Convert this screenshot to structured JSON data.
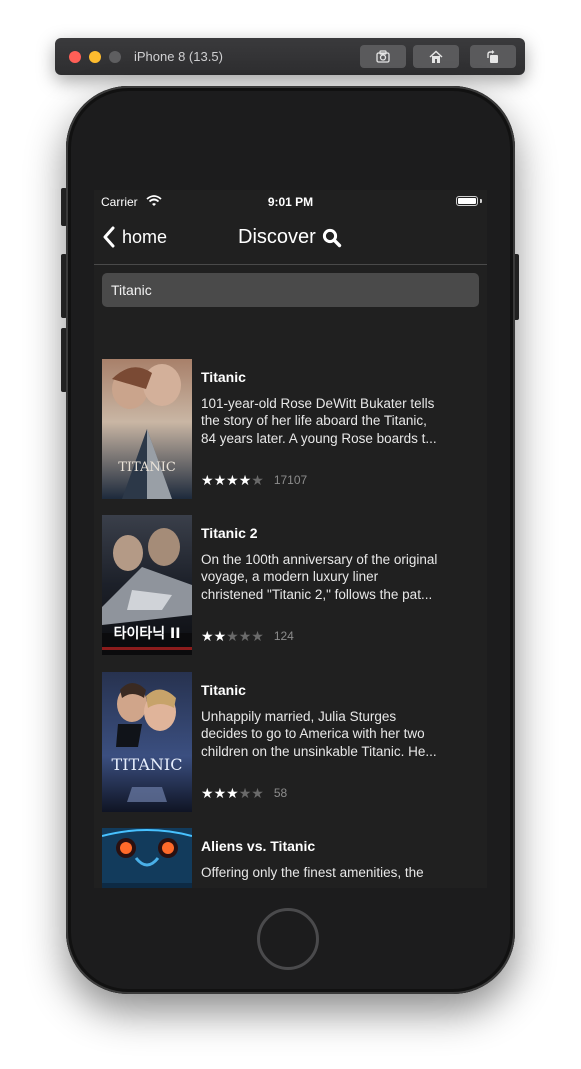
{
  "simulator": {
    "title": "iPhone 8 (13.5)",
    "buttons": [
      "screenshot-icon",
      "home-icon",
      "rotate-icon"
    ]
  },
  "status_bar": {
    "carrier": "Carrier",
    "time": "9:01 PM"
  },
  "nav": {
    "back_label": "home",
    "title": "Discover"
  },
  "search": {
    "value": "Titanic"
  },
  "results": [
    {
      "title": "Titanic",
      "description_lines": [
        "101-year-old Rose DeWitt Bukater tells",
        "the story of her life aboard the Titanic,",
        "84 years later. A young Rose boards t..."
      ],
      "stars": 4,
      "votes": "17107",
      "poster_text": "TITANIC"
    },
    {
      "title": "Titanic 2",
      "description_lines": [
        "On the 100th anniversary of the original",
        "voyage, a modern luxury liner",
        "christened \"Titanic 2,\" follows the pat..."
      ],
      "stars": 2,
      "votes": "124",
      "poster_text": "타이타닉 II"
    },
    {
      "title": "Titanic",
      "description_lines": [
        "Unhappily married, Julia Sturges",
        "decides to go to America with her two",
        "children on the unsinkable Titanic. He..."
      ],
      "stars": 3,
      "votes": "58",
      "poster_text": "TITANIC"
    },
    {
      "title": "Aliens vs. Titanic",
      "description_lines": [
        "Offering only the finest amenities, the",
        "",
        ""
      ],
      "stars": 0,
      "votes": "",
      "poster_text": ""
    }
  ],
  "colors": {
    "background": "#202020",
    "search_field": "#4a4a4a",
    "star_on": "#ffffff",
    "star_off": "#6a6a6a"
  }
}
